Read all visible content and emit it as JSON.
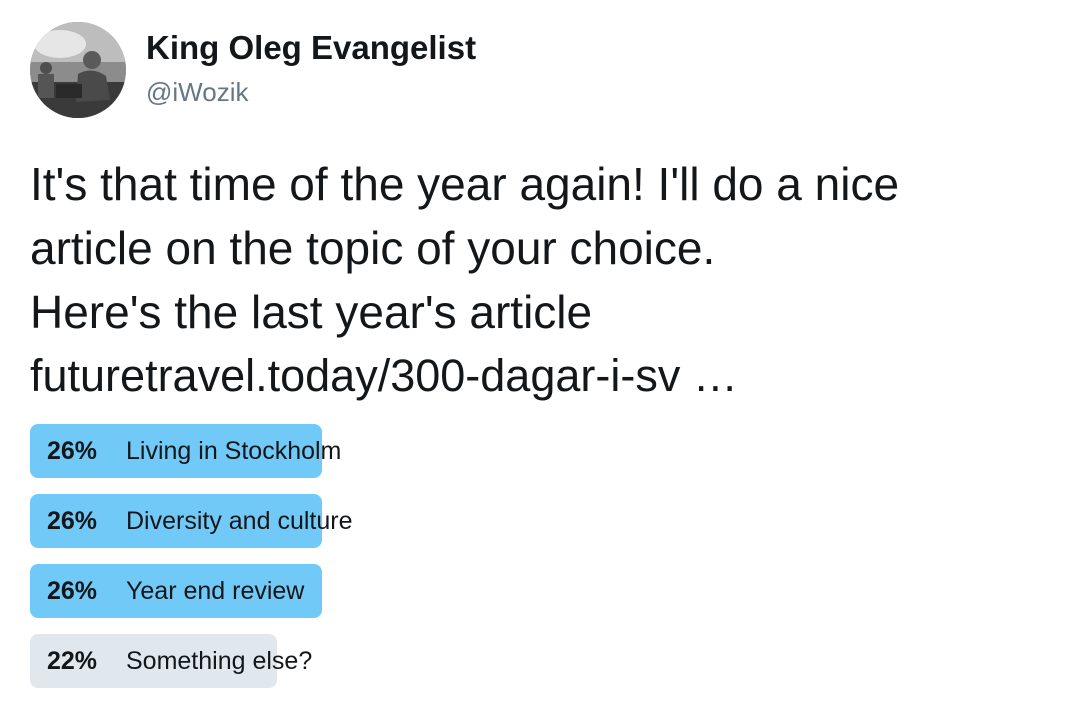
{
  "author": {
    "display_name": "King Oleg Evangelist",
    "handle": "@iWozik",
    "avatar_icon": "profile-photo"
  },
  "tweet": {
    "lines": [
      "It's that time of the year again! I'll do a nice",
      "article on the topic of your choice.",
      "Here's the last year's article",
      "futuretravel.today/300-dagar-i-sv …"
    ]
  },
  "poll": {
    "options": [
      {
        "percent_label": "26%",
        "label": "Living in Stockholm",
        "share": 0.26,
        "highlighted": true
      },
      {
        "percent_label": "26%",
        "label": "Diversity and culture",
        "share": 0.26,
        "highlighted": true
      },
      {
        "percent_label": "26%",
        "label": "Year end review",
        "share": 0.26,
        "highlighted": true
      },
      {
        "percent_label": "22%",
        "label": "Something else?",
        "share": 0.22,
        "highlighted": false
      }
    ]
  },
  "colors": {
    "leading_bar": "#71c9f8",
    "other_bar": "#e1e8ed",
    "handle": "#657786",
    "text": "#14171a"
  }
}
